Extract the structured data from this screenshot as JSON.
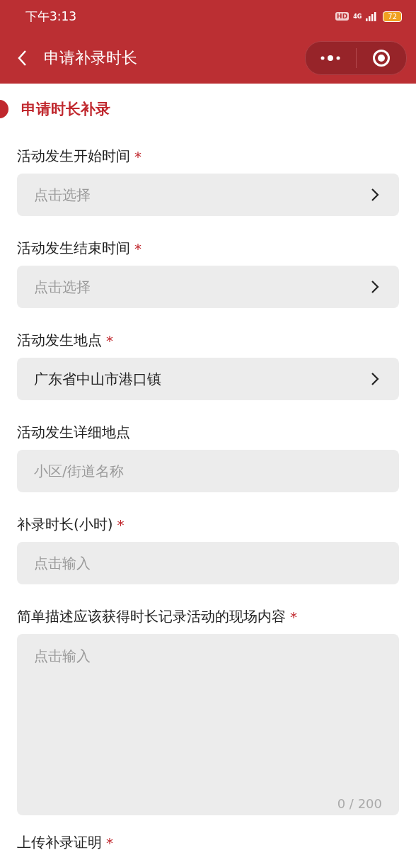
{
  "status_bar": {
    "time": "下午3:13",
    "hd": "HD",
    "network": "4G",
    "battery": "72"
  },
  "header": {
    "title": "申请补录时长"
  },
  "section": {
    "title": "申请时长补录"
  },
  "fields": [
    {
      "kind": "picker",
      "label": "活动发生开始时间",
      "mark": "*",
      "placeholder": "点击选择"
    },
    {
      "kind": "picker",
      "label": "活动发生结束时间",
      "mark": "*",
      "placeholder": "点击选择"
    },
    {
      "kind": "picker",
      "label": "活动发生地点",
      "mark": "*",
      "value": "广东省中山市港口镇"
    },
    {
      "kind": "input",
      "label": "活动发生详细地点",
      "placeholder": "小区/街道名称"
    },
    {
      "kind": "input",
      "label": "补录时长(小时)",
      "mark": "*",
      "placeholder": "点击输入"
    },
    {
      "kind": "textarea",
      "label": "简单描述应该获得时长记录活动的现场内容",
      "mark": "*",
      "placeholder": "点击输入",
      "counter": "0 / 200"
    },
    {
      "kind": "upload",
      "label": "上传补录证明",
      "mark": "*"
    }
  ]
}
